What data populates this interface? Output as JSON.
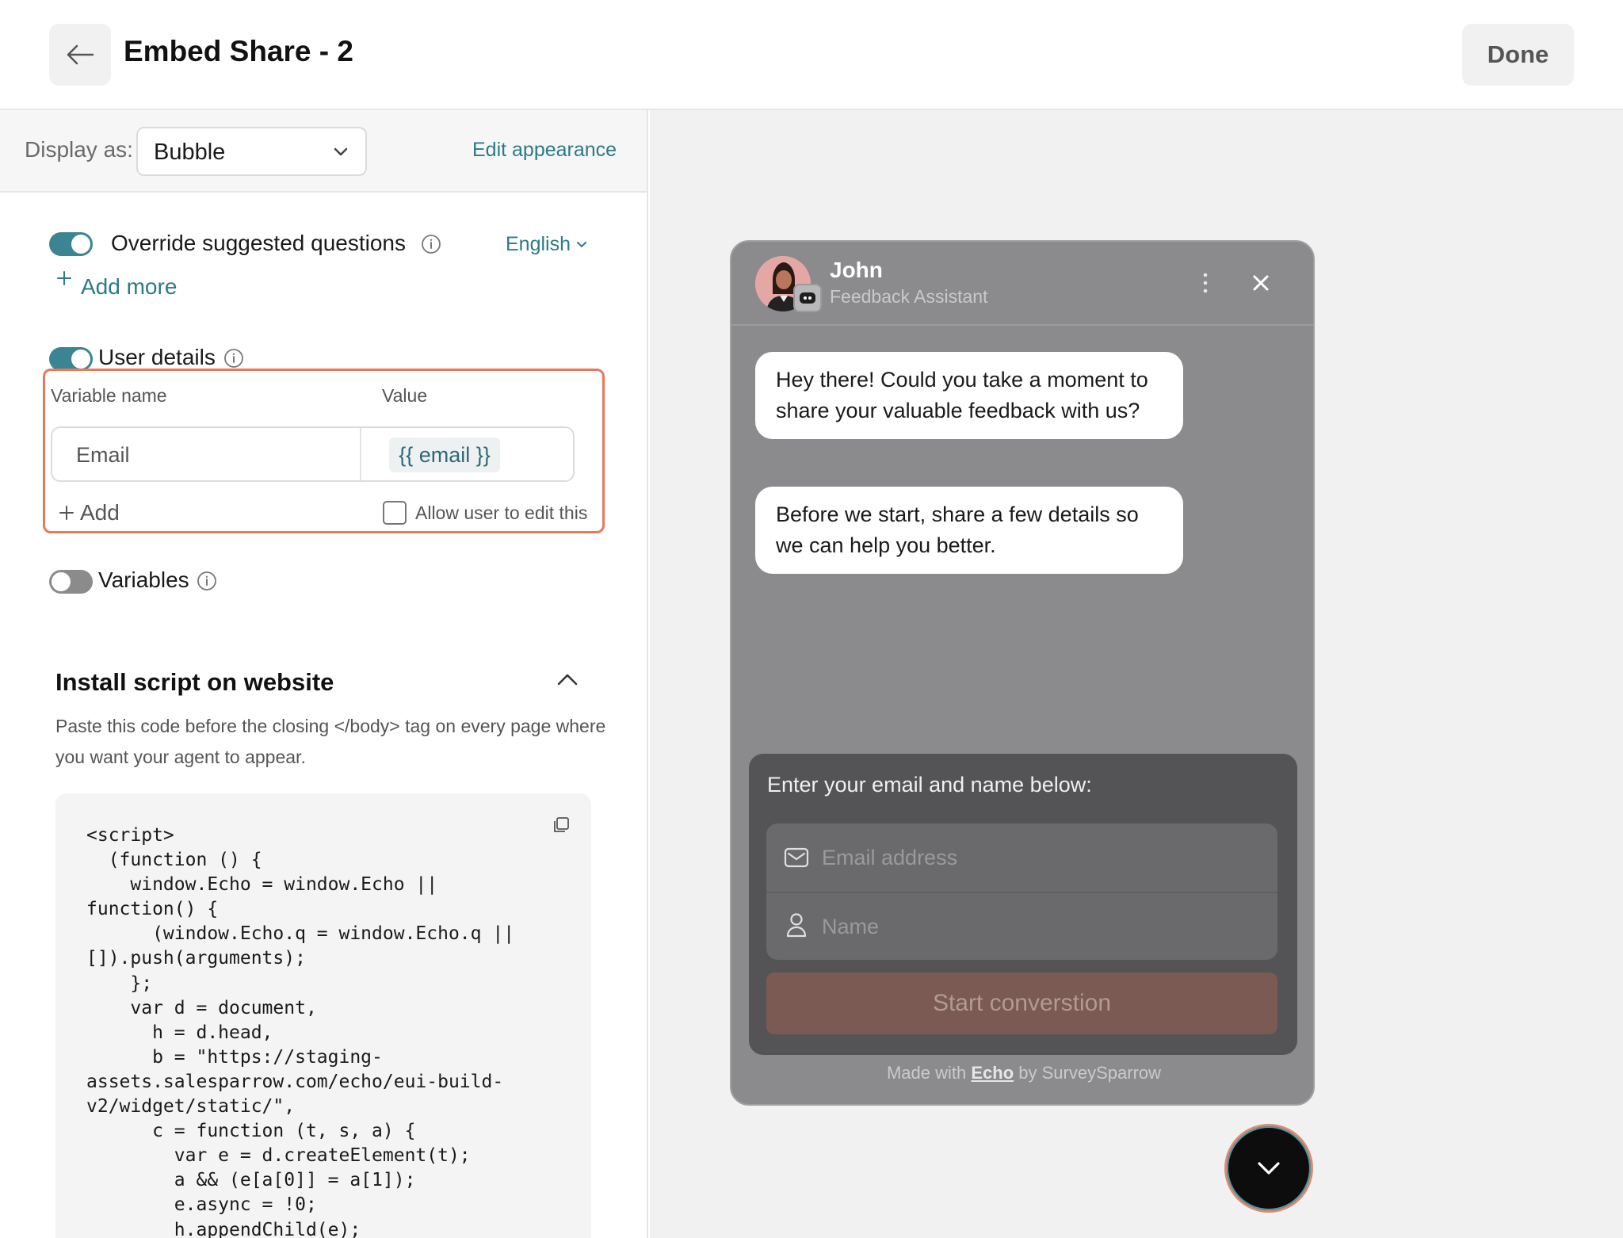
{
  "header": {
    "title": "Embed Share - 2",
    "done_label": "Done"
  },
  "display": {
    "label": "Display as:",
    "selected": "Bubble",
    "edit_appearance": "Edit appearance"
  },
  "override": {
    "label": "Override suggested questions",
    "enabled": true,
    "language": "English",
    "add_more": "Add more"
  },
  "user_details": {
    "label": "User details",
    "enabled": true,
    "col_variable": "Variable name",
    "col_value": "Value",
    "rows": [
      {
        "name": "Email",
        "value": "{{ email }}"
      }
    ],
    "add_label": "Add",
    "allow_edit_label": "Allow user to edit this",
    "allow_edit_checked": false
  },
  "variables": {
    "label": "Variables",
    "enabled": false
  },
  "install": {
    "title": "Install script on website",
    "description": "Paste this code before the closing </body> tag on every page where you want your agent to appear.",
    "code": "<script>\n  (function () {\n    window.Echo = window.Echo ||\nfunction() {\n      (window.Echo.q = window.Echo.q ||\n[]).push(arguments);\n    };\n    var d = document,\n      h = d.head,\n      b = \"https://staging-\nassets.salesparrow.com/echo/eui-build-\nv2/widget/static/\",\n      c = function (t, s, a) {\n        var e = d.createElement(t);\n        a && (e[a[0]] = a[1]);\n        e.async = !0;\n        h.appendChild(e);"
  },
  "widget": {
    "agent_name": "John",
    "agent_role": "Feedback Assistant",
    "messages": [
      "Hey there! Could you take a moment to share your valuable feedback with us?",
      "Before we start, share a few details so we can help you better."
    ],
    "form_title": "Enter your email and name below:",
    "email_placeholder": "Email address",
    "name_placeholder": "Name",
    "start_button": "Start converstion",
    "footer_prefix": "Made with",
    "footer_brand": "Echo",
    "footer_suffix": "by SurveySparrow"
  },
  "colors": {
    "accent": "#3a8591",
    "highlight_border": "#e8795a",
    "start_button": "#7a5a52"
  },
  "icons": [
    "back-arrow-icon",
    "chevron-down-icon",
    "info-icon",
    "plus-icon",
    "chevron-up-icon",
    "copy-icon",
    "more-vertical-icon",
    "close-icon",
    "mail-icon",
    "user-icon",
    "robot-icon"
  ]
}
